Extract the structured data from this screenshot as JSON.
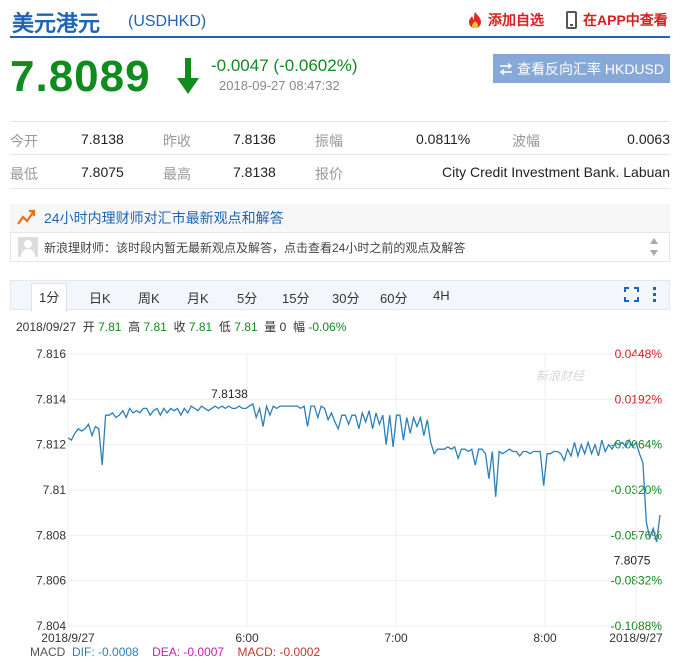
{
  "header": {
    "name": "美元港元",
    "code": "(USDHKD)",
    "add_label": "添加自选",
    "app_label": "在APP中查看"
  },
  "quote": {
    "price": "7.8089",
    "change": "-0.0047 (-0.0602%)",
    "time": "2018-09-27 08:47:32",
    "reverse_label": "查看反向汇率 HKDUSD"
  },
  "stats": {
    "open_label": "今开",
    "open": "7.8138",
    "prev_label": "昨收",
    "prev": "7.8136",
    "amp_label": "振幅",
    "amp": "0.0811%",
    "wave_label": "波幅",
    "wave": "0.0063",
    "low_label": "最低",
    "low": "7.8075",
    "high_label": "最高",
    "high": "7.8138",
    "quote_label": "报价",
    "quote": "City Credit Investment Bank. Labuan"
  },
  "news": {
    "title": "24小时内理财师对汇市最新观点和解答",
    "item": "新浪理财师：该时段内暂无最新观点及解答，点击查看24小时之前的观点及解答"
  },
  "tabs": [
    "1分",
    "日K",
    "周K",
    "月K",
    "5分",
    "15分",
    "30分",
    "60分",
    "4H"
  ],
  "info": {
    "date": "2018/09/27",
    "open_l": "开",
    "open": "7.81",
    "high_l": "高",
    "high": "7.81",
    "close_l": "收",
    "close": "7.81",
    "low_l": "低",
    "low": "7.81",
    "vol_l": "量",
    "vol": "0",
    "amp_l": "幅",
    "amp": "-0.06%"
  },
  "macd": {
    "label": "MACD",
    "dif": "DIF: -0.0008",
    "dea": "DEA: -0.0007",
    "macd": "MACD: -0.0002"
  },
  "colors": {
    "up": "#d6201f",
    "down": "#118a1e",
    "line": "#2c7fb8",
    "brand": "#1f64b3"
  },
  "chart_data": {
    "type": "line",
    "watermark": "新浪财经",
    "y_ticks": [
      "7.816",
      "7.814",
      "7.812",
      "7.81",
      "7.808",
      "7.806",
      "7.804"
    ],
    "pct_ticks": [
      "0.0448%",
      "0.0192%",
      "-0.0064%",
      "-0.0320%",
      "-0.0576%",
      "-0.0832%",
      "-0.1088%"
    ],
    "x_ticks": [
      "2018/9/27",
      "6:00",
      "7:00",
      "8:00",
      "2018/9/27"
    ],
    "ylim": [
      7.804,
      7.816
    ],
    "annotations": [
      {
        "label": "7.8138",
        "x": 0.31,
        "y": 7.8138
      },
      {
        "label": "7.8075",
        "x": 0.99,
        "y": 7.8075
      }
    ],
    "series": [
      {
        "values": [
          7.8123,
          7.8122,
          7.8125,
          7.8127,
          7.8126,
          7.8127,
          7.8129,
          7.8124,
          7.8128,
          7.8127,
          7.8111,
          7.8133,
          7.8133,
          7.8134,
          7.8132,
          7.8133,
          7.8135,
          7.8132,
          7.8136,
          7.8134,
          7.8135,
          7.8134,
          7.8136,
          7.8136,
          7.8133,
          7.8135,
          7.8136,
          7.8133,
          7.8136,
          7.8134,
          7.8136,
          7.8135,
          7.8136,
          7.8133,
          7.8136,
          7.8134,
          7.8137,
          7.8136,
          7.8135,
          7.8137,
          7.8136,
          7.8135,
          7.8136,
          7.8137,
          7.8136,
          7.8137,
          7.8136,
          7.8137,
          7.8136,
          7.8136,
          7.8137,
          7.8136,
          7.8136,
          7.8137,
          7.8138,
          7.8132,
          7.8136,
          7.8128,
          7.8137,
          7.8133,
          7.8137,
          7.8136,
          7.8137,
          7.8137,
          7.8137,
          7.8137,
          7.8137,
          7.8137,
          7.8136,
          7.8137,
          7.8128,
          7.8137,
          7.8137,
          7.8132,
          7.8137,
          7.8136,
          7.8131,
          7.8134,
          7.813,
          7.8127,
          7.8133,
          7.8133,
          7.8129,
          7.8133,
          7.8133,
          7.8127,
          7.8134,
          7.813,
          7.8135,
          7.8127,
          7.8134,
          7.8129,
          7.8133,
          7.812,
          7.8133,
          7.8119,
          7.8133,
          7.8133,
          7.8122,
          7.8132,
          7.8125,
          7.8132,
          7.8128,
          7.8132,
          7.8124,
          7.8131,
          7.8121,
          7.8116,
          7.8118,
          7.8118,
          7.8118,
          7.8119,
          7.8118,
          7.8119,
          7.8114,
          7.8118,
          7.8118,
          7.8117,
          7.8118,
          7.8111,
          7.8118,
          7.8118,
          7.8116,
          7.8105,
          7.8117,
          7.8097,
          7.8117,
          7.8116,
          7.8117,
          7.8118,
          7.8117,
          7.8117,
          7.8115,
          7.8117,
          7.8117,
          7.8116,
          7.8117,
          7.8117,
          7.8117,
          7.8102,
          7.8116,
          7.8116,
          7.8117,
          7.8117,
          7.8116,
          7.8113,
          7.8118,
          7.8115,
          7.8121,
          7.8115,
          7.812,
          7.8116,
          7.8121,
          7.8116,
          7.812,
          7.8115,
          7.8122,
          7.8117,
          7.812,
          7.8118,
          7.8121,
          7.812,
          7.8121,
          7.8119,
          7.8122,
          7.8119,
          7.8121,
          7.8116,
          7.8112,
          7.8086,
          7.8079,
          7.8083,
          7.8077,
          7.8089
        ]
      }
    ]
  }
}
